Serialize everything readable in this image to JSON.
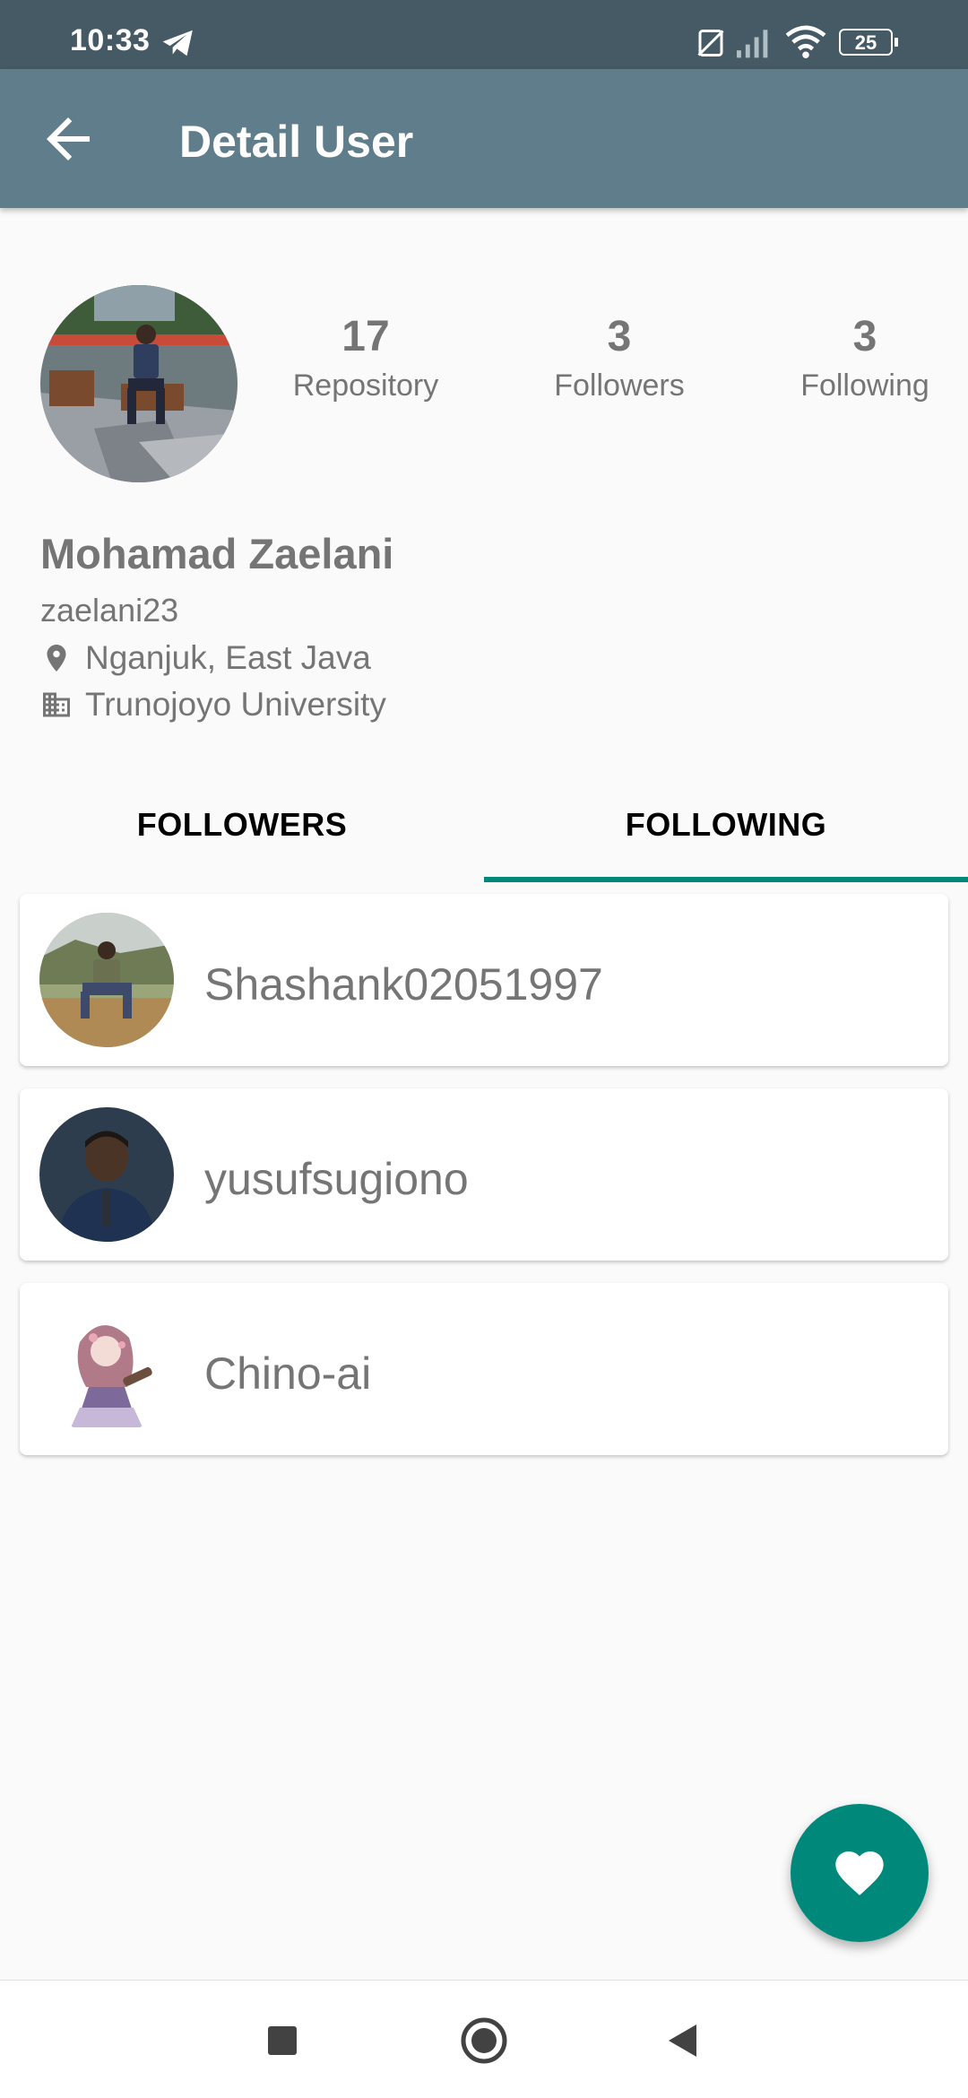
{
  "status_bar": {
    "time": "10:33",
    "battery": "25",
    "icons": [
      "telegram-icon",
      "no-sim-icon",
      "signal-icon",
      "wifi-icon",
      "battery-icon"
    ]
  },
  "app_bar": {
    "title": "Detail User",
    "back_icon": "arrow-back-icon",
    "background": "#607D8B",
    "status_background": "#455A64"
  },
  "profile": {
    "stats": [
      {
        "value": "17",
        "label": "Repository"
      },
      {
        "value": "3",
        "label": "Followers"
      },
      {
        "value": "3",
        "label": "Following"
      }
    ],
    "name": "Mohamad Zaelani",
    "login": "zaelani23",
    "location": "Nganjuk, East Java",
    "company": "Trunojoyo University"
  },
  "tabs": [
    {
      "label": "FOLLOWERS",
      "selected": false
    },
    {
      "label": "FOLLOWING",
      "selected": true
    }
  ],
  "following_list": [
    {
      "username": "Shashank02051997"
    },
    {
      "username": "yusufsugiono"
    },
    {
      "username": "Chino-ai"
    }
  ],
  "fab": {
    "icon": "heart-icon",
    "color": "#00897B"
  },
  "nav_bar": {
    "icons": [
      "recent-apps-icon",
      "home-icon",
      "back-icon"
    ]
  },
  "accent_color": "#00897B"
}
